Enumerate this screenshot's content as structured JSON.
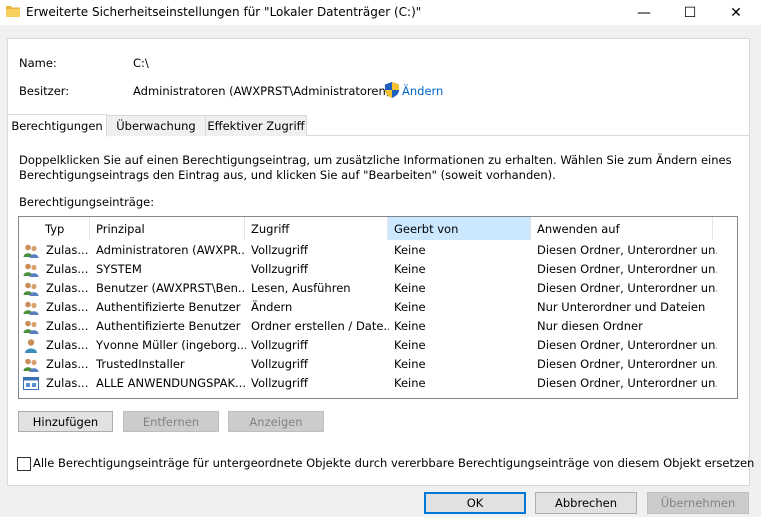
{
  "window": {
    "title": "Erweiterte Sicherheitseinstellungen für \"Lokaler Datenträger (C:)\"",
    "minimize": "—",
    "maximize": "☐",
    "close": "✕"
  },
  "info": {
    "name_label": "Name:",
    "name_value": "C:\\",
    "owner_label": "Besitzer:",
    "owner_value": "Administratoren (AWXPRST\\Administratoren)",
    "change_link": "Ändern"
  },
  "tabs": [
    {
      "label": "Berechtigungen",
      "active": true
    },
    {
      "label": "Überwachung",
      "active": false
    },
    {
      "label": "Effektiver Zugriff",
      "active": false
    }
  ],
  "description_line1": "Doppelklicken Sie auf einen Berechtigungseintrag, um zusätzliche Informationen zu erhalten. Wählen Sie zum Ändern eines",
  "description_line2": "Berechtigungseintrags den Eintrag aus, und klicken Sie auf \"Bearbeiten\" (soweit vorhanden).",
  "entries_label": "Berechtigungseinträge:",
  "columns": [
    "Typ",
    "Prinzipal",
    "Zugriff",
    "Geerbt von",
    "Anwenden auf"
  ],
  "rows": [
    {
      "icon": "users-icon",
      "typ": "Zulas...",
      "prinzipal": "Administratoren (AWXPR...",
      "zugriff": "Vollzugriff",
      "geerbt": "Keine",
      "anwenden": "Diesen Ordner, Unterordner un..."
    },
    {
      "icon": "users-icon",
      "typ": "Zulas...",
      "prinzipal": "SYSTEM",
      "zugriff": "Vollzugriff",
      "geerbt": "Keine",
      "anwenden": "Diesen Ordner, Unterordner un..."
    },
    {
      "icon": "users-icon",
      "typ": "Zulas...",
      "prinzipal": "Benutzer (AWXPRST\\Ben...",
      "zugriff": "Lesen, Ausführen",
      "geerbt": "Keine",
      "anwenden": "Diesen Ordner, Unterordner un..."
    },
    {
      "icon": "users-icon",
      "typ": "Zulas...",
      "prinzipal": "Authentifizierte Benutzer",
      "zugriff": "Ändern",
      "geerbt": "Keine",
      "anwenden": "Nur Unterordner und Dateien"
    },
    {
      "icon": "users-icon",
      "typ": "Zulas...",
      "prinzipal": "Authentifizierte Benutzer",
      "zugriff": "Ordner erstellen / Date...",
      "geerbt": "Keine",
      "anwenden": "Nur diesen Ordner"
    },
    {
      "icon": "user-icon",
      "typ": "Zulas...",
      "prinzipal": "Yvonne Müller (ingeborg...",
      "zugriff": "Vollzugriff",
      "geerbt": "Keine",
      "anwenden": "Diesen Ordner, Unterordner un..."
    },
    {
      "icon": "users-icon",
      "typ": "Zulas...",
      "prinzipal": "TrustedInstaller",
      "zugriff": "Vollzugriff",
      "geerbt": "Keine",
      "anwenden": "Diesen Ordner, Unterordner un..."
    },
    {
      "icon": "app-package-icon",
      "typ": "Zulas...",
      "prinzipal": "ALLE ANWENDUNGSPAK...",
      "zugriff": "Vollzugriff",
      "geerbt": "Keine",
      "anwenden": "Diesen Ordner, Unterordner un..."
    }
  ],
  "buttons": {
    "add": "Hinzufügen",
    "remove": "Entfernen",
    "view": "Anzeigen"
  },
  "replace_checkbox_label": "Alle Berechtigungseinträge für untergeordnete Objekte durch vererbbare Berechtigungseinträge von diesem Objekt ersetzen",
  "dialog_buttons": {
    "ok": "OK",
    "cancel": "Abbrechen",
    "apply": "Übernehmen"
  }
}
